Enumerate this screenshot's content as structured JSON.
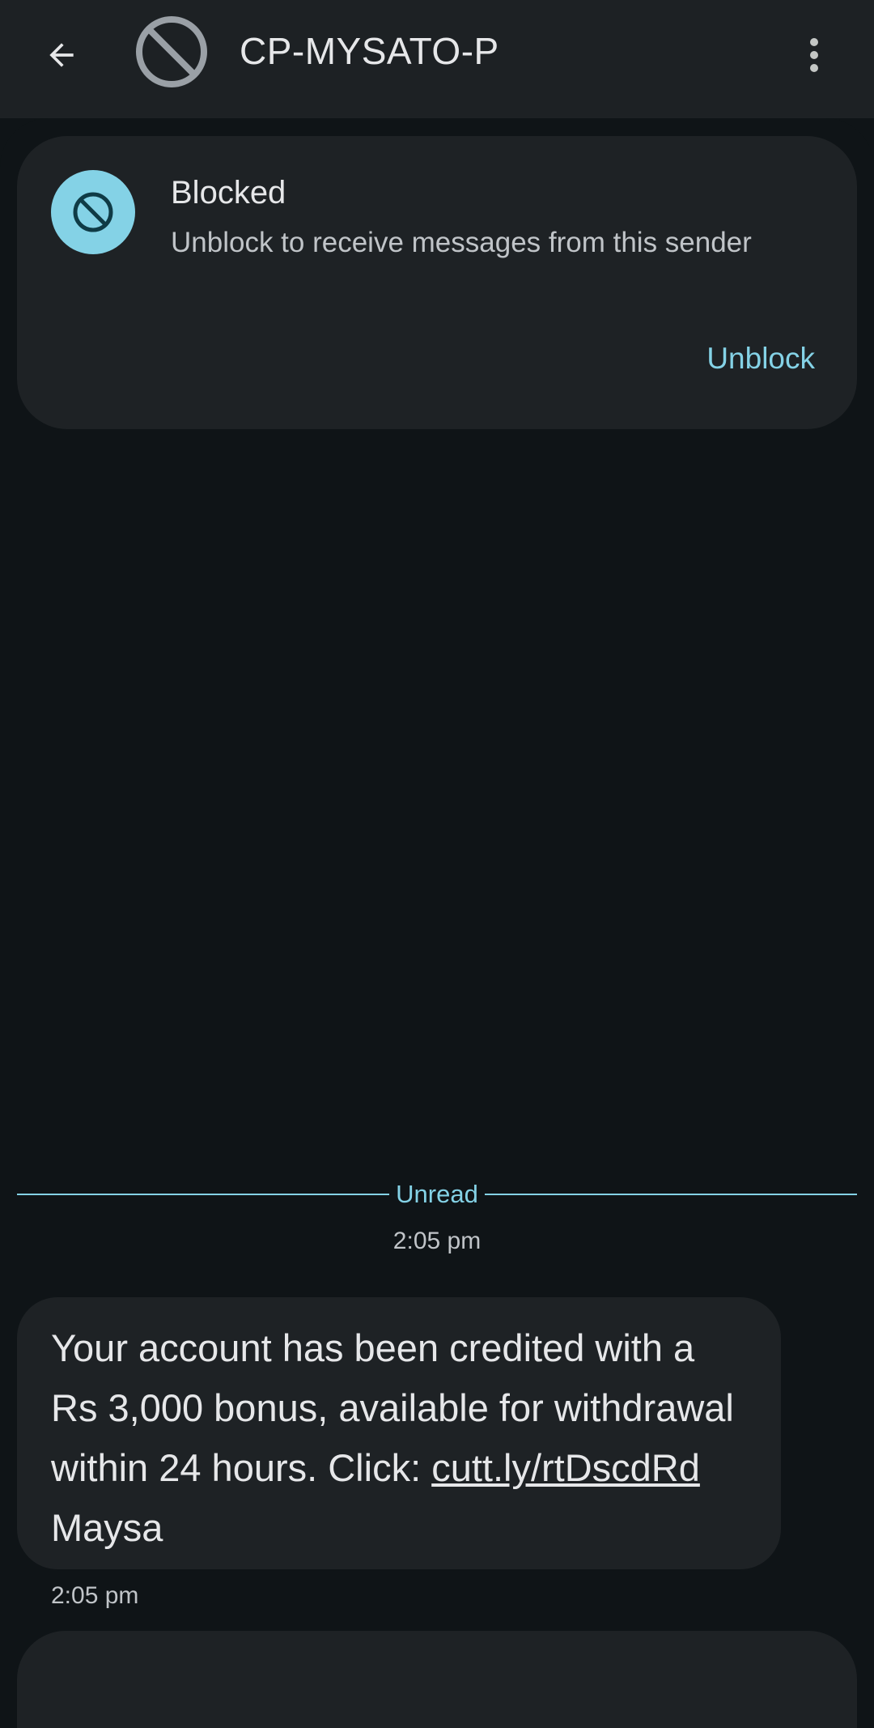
{
  "header": {
    "title": "CP-MYSATO-P",
    "back_icon": "arrow-back-icon",
    "avatar_icon": "blocked-avatar-icon",
    "more_icon": "more-vert-icon"
  },
  "blocked_card": {
    "icon": "block-icon",
    "title": "Blocked",
    "subtitle": "Unblock to receive messages from this sender",
    "action_label": "Unblock"
  },
  "conversation": {
    "unread_label": "Unread",
    "timestamp": "2:05 pm",
    "messages": [
      {
        "text_before_link": "Your account has been credited with a Rs 3,000 bonus, available for withdrawal within 24 hours. Click: ",
        "link": "cutt.ly/rtDscdRd",
        "text_after_link": " Maysa",
        "time": "2:05 pm"
      }
    ]
  },
  "colors": {
    "accent": "#84d2e6",
    "surface": "#1e2225",
    "background": "#0f1417",
    "topbar": "#1d2124"
  }
}
